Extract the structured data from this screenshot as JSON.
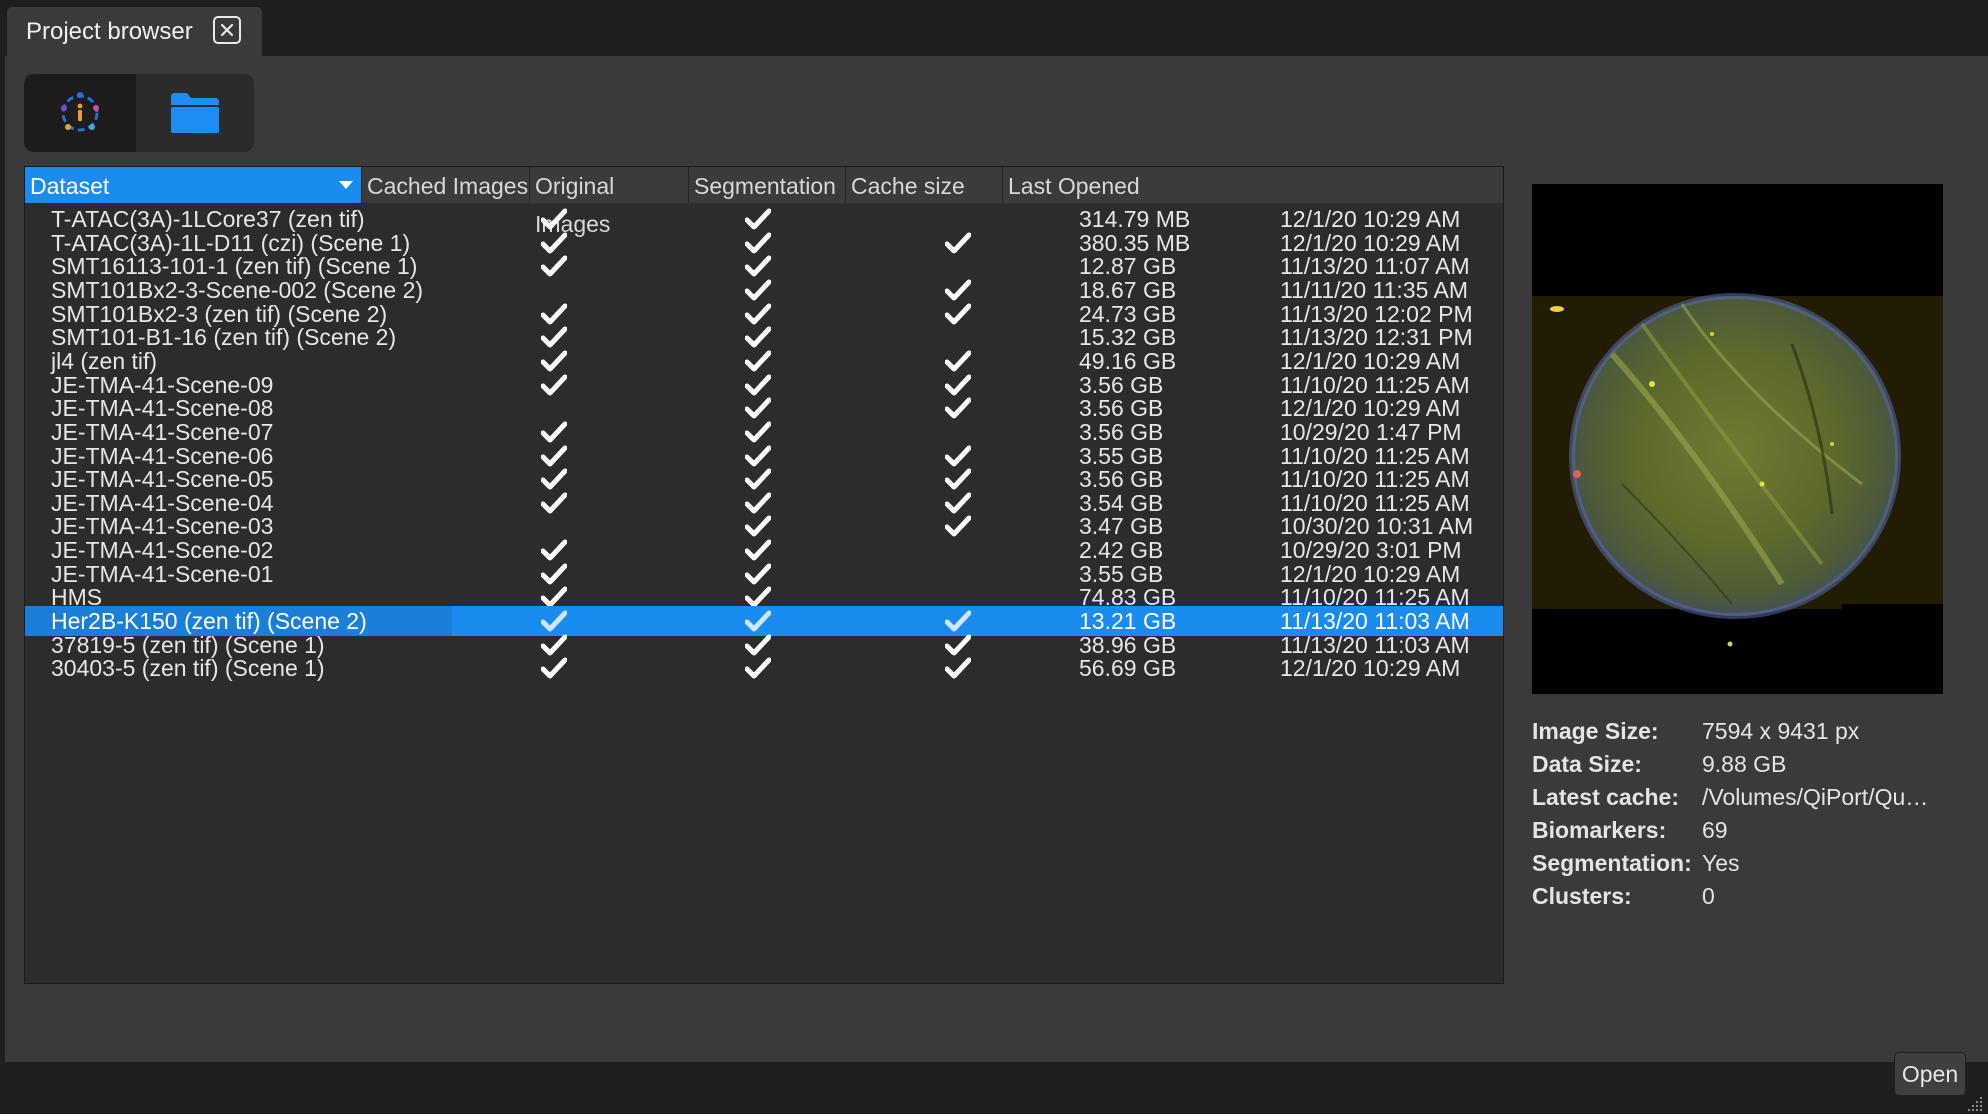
{
  "tab": {
    "title": "Project browser"
  },
  "toolbar": {
    "info_icon": "info-icon",
    "folder_icon": "folder-icon"
  },
  "colors": {
    "accent": "#1a8cf0",
    "panel": "#3a3a3a",
    "table_bg": "#2c2c2c"
  },
  "table": {
    "columns": [
      "Dataset",
      "Cached Images",
      "Original Images",
      "Segmentation",
      "Cache size",
      "Last Opened"
    ],
    "sorted_column": "Dataset",
    "selected_row": 17,
    "rows": [
      {
        "name": "T-ATAC(3A)-1LCore37 (zen tif)",
        "cached": true,
        "original": true,
        "segmentation": false,
        "size": "314.79 MB",
        "last": "12/1/20 10:29 AM"
      },
      {
        "name": "T-ATAC(3A)-1L-D11 (czi) (Scene 1)",
        "cached": true,
        "original": true,
        "segmentation": true,
        "size": "380.35 MB",
        "last": "12/1/20 10:29 AM"
      },
      {
        "name": "SMT16113-101-1 (zen tif) (Scene 1)",
        "cached": true,
        "original": true,
        "segmentation": false,
        "size": "12.87 GB",
        "last": "11/13/20 11:07 AM"
      },
      {
        "name": "SMT101Bx2-3-Scene-002 (Scene 2)",
        "cached": false,
        "original": true,
        "segmentation": true,
        "size": "18.67 GB",
        "last": "11/11/20 11:35 AM"
      },
      {
        "name": "SMT101Bx2-3 (zen tif) (Scene 2)",
        "cached": true,
        "original": true,
        "segmentation": true,
        "size": "24.73 GB",
        "last": "11/13/20 12:02 PM"
      },
      {
        "name": "SMT101-B1-16 (zen tif) (Scene 2)",
        "cached": true,
        "original": true,
        "segmentation": false,
        "size": "15.32 GB",
        "last": "11/13/20 12:31 PM"
      },
      {
        "name": "jl4 (zen tif)",
        "cached": true,
        "original": true,
        "segmentation": true,
        "size": "49.16 GB",
        "last": "12/1/20 10:29 AM"
      },
      {
        "name": "JE-TMA-41-Scene-09",
        "cached": true,
        "original": true,
        "segmentation": true,
        "size": "3.56 GB",
        "last": "11/10/20 11:25 AM"
      },
      {
        "name": "JE-TMA-41-Scene-08",
        "cached": false,
        "original": true,
        "segmentation": true,
        "size": "3.56 GB",
        "last": "12/1/20 10:29 AM"
      },
      {
        "name": "JE-TMA-41-Scene-07",
        "cached": true,
        "original": true,
        "segmentation": false,
        "size": "3.56 GB",
        "last": "10/29/20 1:47 PM"
      },
      {
        "name": "JE-TMA-41-Scene-06",
        "cached": true,
        "original": true,
        "segmentation": true,
        "size": "3.55 GB",
        "last": "11/10/20 11:25 AM"
      },
      {
        "name": "JE-TMA-41-Scene-05",
        "cached": true,
        "original": true,
        "segmentation": true,
        "size": "3.56 GB",
        "last": "11/10/20 11:25 AM"
      },
      {
        "name": "JE-TMA-41-Scene-04",
        "cached": true,
        "original": true,
        "segmentation": true,
        "size": "3.54 GB",
        "last": "11/10/20 11:25 AM"
      },
      {
        "name": "JE-TMA-41-Scene-03",
        "cached": false,
        "original": true,
        "segmentation": true,
        "size": "3.47 GB",
        "last": "10/30/20 10:31 AM"
      },
      {
        "name": "JE-TMA-41-Scene-02",
        "cached": true,
        "original": true,
        "segmentation": false,
        "size": "2.42 GB",
        "last": "10/29/20 3:01 PM"
      },
      {
        "name": "JE-TMA-41-Scene-01",
        "cached": true,
        "original": true,
        "segmentation": false,
        "size": "3.55 GB",
        "last": "12/1/20 10:29 AM"
      },
      {
        "name": "HMS",
        "cached": true,
        "original": true,
        "segmentation": false,
        "size": "74.83 GB",
        "last": "11/10/20 11:25 AM"
      },
      {
        "name": "Her2B-K150 (zen tif) (Scene 2)",
        "cached": true,
        "original": true,
        "segmentation": true,
        "size": "13.21 GB",
        "last": "11/13/20 11:03 AM"
      },
      {
        "name": "37819-5 (zen tif) (Scene 1)",
        "cached": true,
        "original": true,
        "segmentation": true,
        "size": "38.96 GB",
        "last": "11/13/20 11:03 AM"
      },
      {
        "name": "30403-5 (zen tif) (Scene 1)",
        "cached": true,
        "original": true,
        "segmentation": true,
        "size": "56.69 GB",
        "last": "12/1/20 10:29 AM"
      }
    ]
  },
  "details": [
    {
      "label": "Image Size:",
      "value": "7594 x 9431 px"
    },
    {
      "label": "Data Size:",
      "value": "9.88 GB"
    },
    {
      "label": "Latest cache:",
      "value": "/Volumes/QiPort/Qu…"
    },
    {
      "label": "Biomarkers:",
      "value": "69"
    },
    {
      "label": "Segmentation:",
      "value": "Yes"
    },
    {
      "label": "Clusters:",
      "value": "0"
    }
  ],
  "open_button": "Open"
}
